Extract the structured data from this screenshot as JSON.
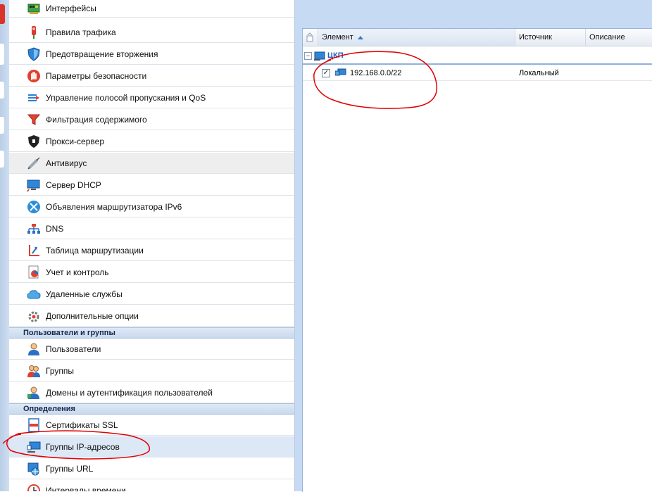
{
  "nav": {
    "items": [
      {
        "label": "Интерфейсы",
        "icon": "network-card-icon"
      },
      {
        "label": "Правила трафика",
        "icon": "traffic-light-icon"
      },
      {
        "label": "Предотвращение вторжения",
        "icon": "shield-icon"
      },
      {
        "label": "Параметры безопасности",
        "icon": "hand-stop-icon"
      },
      {
        "label": "Управление полосой пропускания и QoS",
        "icon": "bandwidth-arrows-icon"
      },
      {
        "label": "Фильтрация содержимого",
        "icon": "funnel-icon"
      },
      {
        "label": "Прокси-сервер",
        "icon": "proxy-shield-icon"
      },
      {
        "label": "Антивирус",
        "icon": "syringe-icon",
        "selected": true
      },
      {
        "label": "Сервер DHCP",
        "icon": "monitor-icon"
      },
      {
        "label": "Объявления маршрутизатора IPv6",
        "icon": "router-icon"
      },
      {
        "label": "DNS",
        "icon": "dns-tree-icon"
      },
      {
        "label": "Таблица маршрутизации",
        "icon": "routing-axes-icon"
      },
      {
        "label": "Учет и контроль",
        "icon": "report-chart-icon"
      },
      {
        "label": "Удаленные службы",
        "icon": "cloud-icon"
      },
      {
        "label": "Дополнительные опции",
        "icon": "gear-icon"
      }
    ],
    "sections": [
      {
        "title": "Пользователи и группы",
        "items": [
          {
            "label": "Пользователи",
            "icon": "user-icon"
          },
          {
            "label": "Группы",
            "icon": "users-group-icon"
          },
          {
            "label": "Домены и аутентификация пользователей",
            "icon": "user-domain-icon"
          }
        ]
      },
      {
        "title": "Определения",
        "items": [
          {
            "label": "Сертификаты SSL",
            "icon": "certificate-icon"
          },
          {
            "label": "Группы IP-адресов",
            "icon": "ip-group-icon",
            "highlighted": true
          },
          {
            "label": "Группы URL",
            "icon": "url-group-icon"
          },
          {
            "label": "Интервалы времени",
            "icon": "clock-icon"
          }
        ]
      }
    ]
  },
  "grid": {
    "columns": [
      {
        "label": "Элемент",
        "sort": "ascending"
      },
      {
        "label": "Источник"
      },
      {
        "label": "Описание"
      }
    ],
    "group": {
      "label": "ЦКП",
      "expander": "⊟"
    },
    "rows": [
      {
        "item": "192.168.0.0/22",
        "source": "Локальный",
        "description": "",
        "checked": true
      }
    ]
  },
  "colors": {
    "accent": "#1f5fbf",
    "panel_bg": "#c6daf4",
    "section_bg": "#d3e1f2",
    "annotation": "#e00000",
    "selected_row": "#eeeeee",
    "highlight_row": "#dde8f6"
  }
}
